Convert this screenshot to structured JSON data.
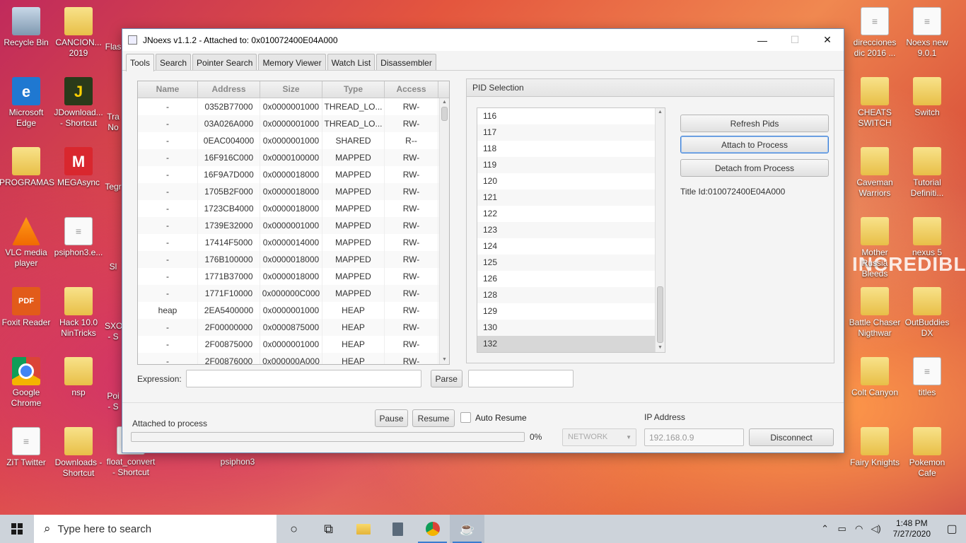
{
  "desktop": {
    "left_icons": [
      {
        "label": "Recycle Bin",
        "icon": "recycle-bin-icon"
      },
      {
        "label": "Microsoft Edge",
        "icon": "edge-icon"
      },
      {
        "label": "PROGRAMAS",
        "icon": "folder-icon"
      },
      {
        "label": "VLC media player",
        "icon": "vlc-icon"
      },
      {
        "label": "Foxit Reader",
        "icon": "pdf-icon"
      },
      {
        "label": "Google Chrome",
        "icon": "chrome-icon"
      },
      {
        "label": "ZiT Twitter",
        "icon": "file-icon"
      }
    ],
    "second_icons": [
      {
        "label": "CANCION... 2019",
        "icon": "folder-icon"
      },
      {
        "label": "JDownload... - Shortcut",
        "icon": "jdownloader-icon"
      },
      {
        "label": "MEGAsync",
        "icon": "mega-icon"
      },
      {
        "label": "psiphon3.e...",
        "icon": "file-icon"
      },
      {
        "label": "Hack 10.0 NinTricks",
        "icon": "folder-icon"
      },
      {
        "label": "nsp",
        "icon": "folder-icon"
      },
      {
        "label": "Downloads - Shortcut",
        "icon": "folder-icon"
      }
    ],
    "third_partial": [
      "Flas",
      "Tra\nNo",
      "Tegr",
      "Sl",
      "SXO\n- S",
      "Poi\n- S"
    ],
    "third_labels": [
      "float_convert - Shortcut",
      "psiphon3"
    ],
    "right_col1": [
      {
        "label": "direcciones dic 2016 ...",
        "icon": "file-icon"
      },
      {
        "label": "CHEATS SWITCH",
        "icon": "folder-icon"
      },
      {
        "label": "Caveman Warriors",
        "icon": "folder-icon"
      },
      {
        "label": "Mother Russia Bleeds",
        "icon": "folder-icon"
      },
      {
        "label": "Battle Chaser Nigthwar",
        "icon": "folder-icon"
      },
      {
        "label": "Colt Canyon",
        "icon": "folder-icon"
      },
      {
        "label": "Fairy Knights",
        "icon": "folder-icon"
      }
    ],
    "right_col2": [
      {
        "label": "Noexs new 9.0.1",
        "icon": "file-icon"
      },
      {
        "label": "Switch",
        "icon": "folder-icon"
      },
      {
        "label": "Tutorial Definiti...",
        "icon": "folder-icon"
      },
      {
        "label": "nexus 5",
        "icon": "folder-icon"
      },
      {
        "label": "OutBuddies DX",
        "icon": "folder-icon"
      },
      {
        "label": "titles",
        "icon": "file-icon"
      },
      {
        "label": "Pokemon Cafe",
        "icon": "folder-icon"
      }
    ],
    "wallpaper_text": "INCREDIBLE"
  },
  "window": {
    "title": "JNoexs v1.1.2 - Attached to: 0x010072400E04A000",
    "minimize": "—",
    "maximize": "☐",
    "close": "✕"
  },
  "tabs": [
    "Tools",
    "Search",
    "Pointer Search",
    "Memory Viewer",
    "Watch List",
    "Disassembler"
  ],
  "memory_table": {
    "columns": [
      "Name",
      "Address",
      "Size",
      "Type",
      "Access"
    ],
    "rows": [
      [
        "-",
        "0352B77000",
        "0x0000001000",
        "THREAD_LO...",
        "RW-"
      ],
      [
        "-",
        "03A026A000",
        "0x0000001000",
        "THREAD_LO...",
        "RW-"
      ],
      [
        "-",
        "0EAC004000",
        "0x0000001000",
        "SHARED",
        "R--"
      ],
      [
        "-",
        "16F916C000",
        "0x0000100000",
        "MAPPED",
        "RW-"
      ],
      [
        "-",
        "16F9A7D000",
        "0x0000018000",
        "MAPPED",
        "RW-"
      ],
      [
        "-",
        "1705B2F000",
        "0x0000018000",
        "MAPPED",
        "RW-"
      ],
      [
        "-",
        "1723CB4000",
        "0x0000018000",
        "MAPPED",
        "RW-"
      ],
      [
        "-",
        "1739E32000",
        "0x0000001000",
        "MAPPED",
        "RW-"
      ],
      [
        "-",
        "17414F5000",
        "0x0000014000",
        "MAPPED",
        "RW-"
      ],
      [
        "-",
        "176B100000",
        "0x0000018000",
        "MAPPED",
        "RW-"
      ],
      [
        "-",
        "1771B37000",
        "0x0000018000",
        "MAPPED",
        "RW-"
      ],
      [
        "-",
        "1771F10000",
        "0x000000C000",
        "MAPPED",
        "RW-"
      ],
      [
        "heap",
        "2EA5400000",
        "0x0000001000",
        "HEAP",
        "RW-"
      ],
      [
        "-",
        "2F00000000",
        "0x0000875000",
        "HEAP",
        "RW-"
      ],
      [
        "-",
        "2F00875000",
        "0x0000001000",
        "HEAP",
        "RW-"
      ],
      [
        "-",
        "2F00876000",
        "0x000000A000",
        "HEAP",
        "RW-"
      ]
    ]
  },
  "expression": {
    "label": "Expression:",
    "value": "",
    "parse": "Parse",
    "result": ""
  },
  "pid_panel": {
    "title": "PID Selection",
    "pids": [
      "116",
      "117",
      "118",
      "119",
      "120",
      "121",
      "122",
      "123",
      "124",
      "125",
      "126",
      "128",
      "129",
      "130",
      "132"
    ],
    "selected": "132",
    "refresh": "Refresh Pids",
    "attach": "Attach to Process",
    "detach": "Detach from Process",
    "title_id": "Title Id:010072400E04A000"
  },
  "bottom": {
    "status": "Attached to process",
    "progress_percent": 0,
    "progress_label": "0%",
    "pause": "Pause",
    "resume": "Resume",
    "auto_resume": "Auto Resume",
    "network": "NETWORK",
    "ip_label": "IP Address",
    "ip_value": "192.168.0.9",
    "disconnect": "Disconnect"
  },
  "taskbar": {
    "search_placeholder": "Type here to search",
    "time": "1:48 PM",
    "date": "7/27/2020"
  },
  "colors": {
    "accent": "#3c7fd6",
    "window_border": "#6b8db7",
    "taskbar": "#cdd3da"
  }
}
